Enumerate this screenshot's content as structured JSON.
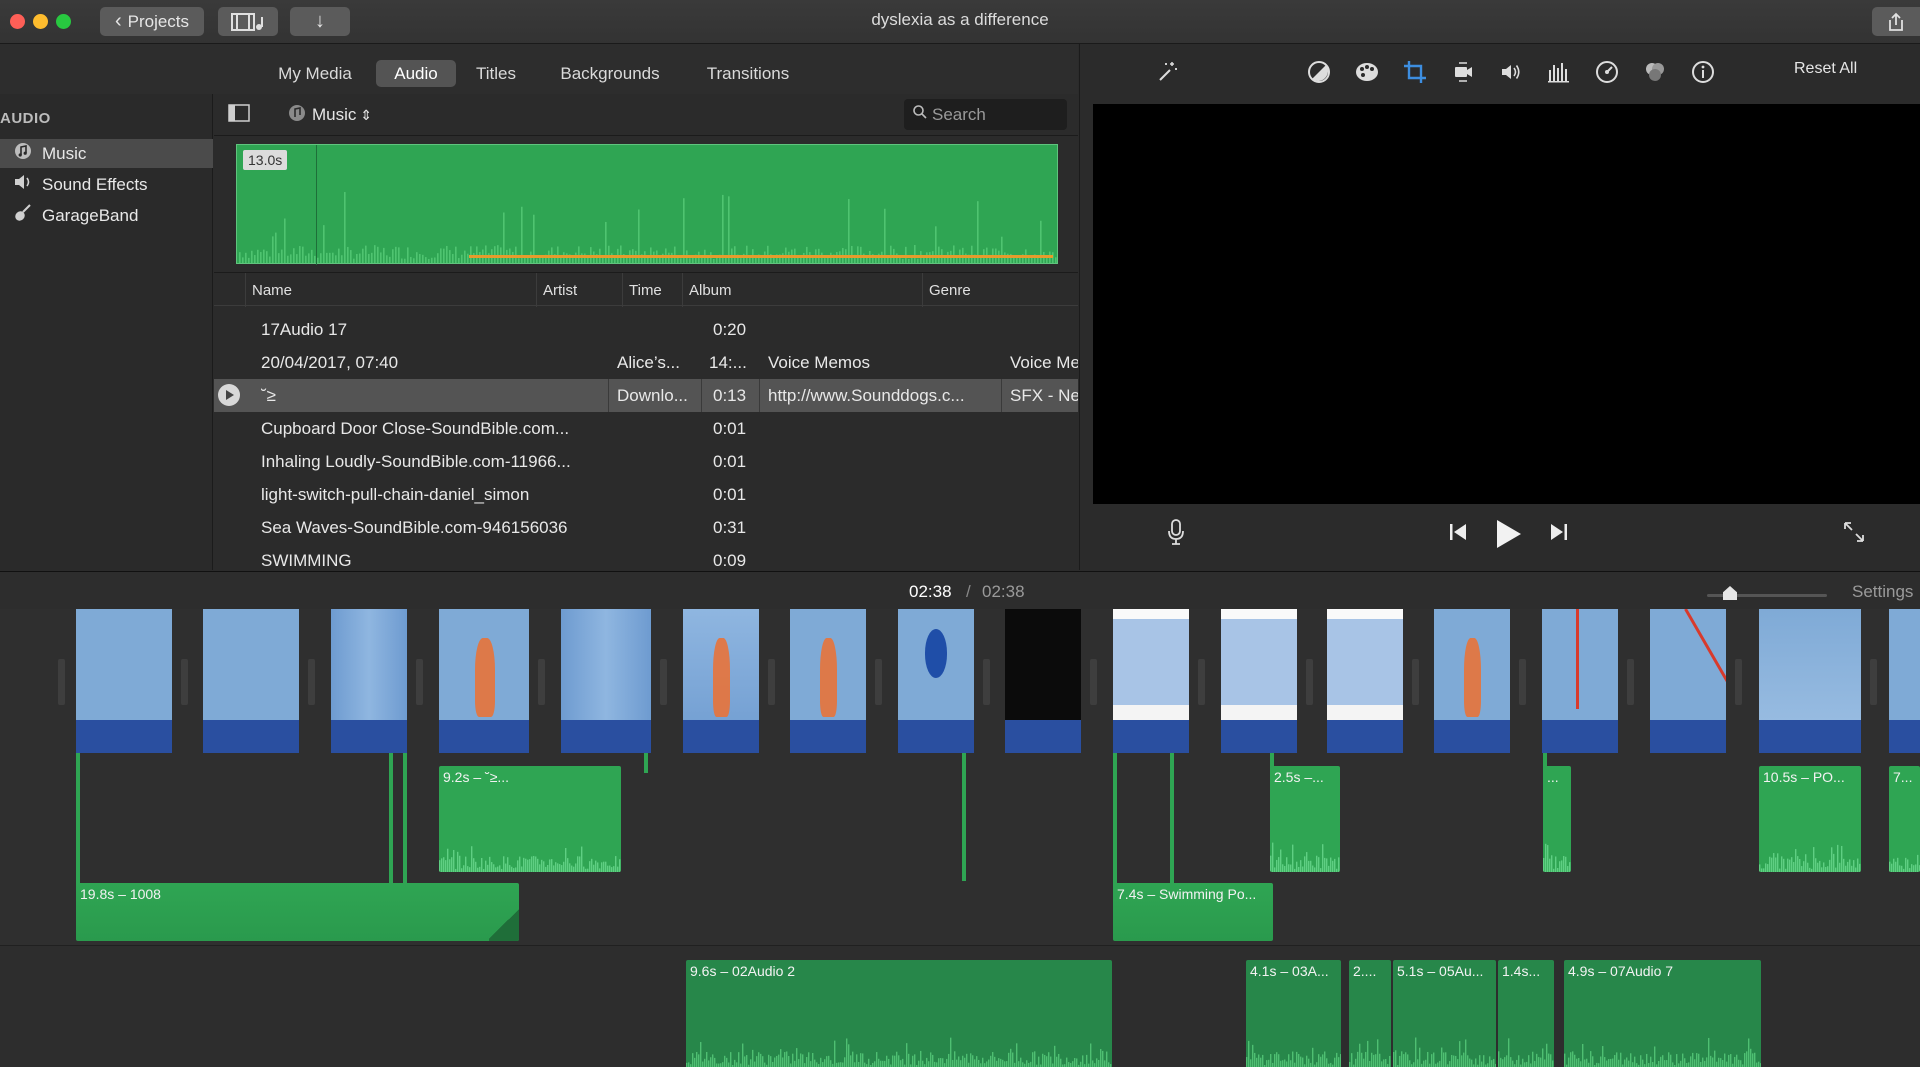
{
  "window": {
    "title": "dyslexia as a difference",
    "projects_label": "Projects"
  },
  "tabs": [
    {
      "label": "My Media",
      "active": false
    },
    {
      "label": "Audio",
      "active": true
    },
    {
      "label": "Titles",
      "active": false
    },
    {
      "label": "Backgrounds",
      "active": false
    },
    {
      "label": "Transitions",
      "active": false
    }
  ],
  "sidebar": {
    "heading": "AUDIO",
    "items": [
      {
        "label": "Music",
        "icon": "music-note-icon",
        "selected": true
      },
      {
        "label": "Sound Effects",
        "icon": "speaker-icon",
        "selected": false
      },
      {
        "label": "GarageBand",
        "icon": "guitar-icon",
        "selected": false
      }
    ]
  },
  "browser": {
    "source_label": "Music",
    "search_placeholder": "Search",
    "preview_duration": "13.0s",
    "columns": [
      "Name",
      "Artist",
      "Time",
      "Album",
      "Genre"
    ],
    "rows": [
      {
        "name": "17Audio 17",
        "artist": "",
        "time": "0:20",
        "album": "",
        "genre": ""
      },
      {
        "name": "20/04/2017, 07:40",
        "artist": "Alice’s...",
        "time": "14:...",
        "album": "Voice Memos",
        "genre": "Voice Me"
      },
      {
        "name": "˘≥",
        "artist": "Downlo...",
        "time": "0:13",
        "album": "http://www.Sounddogs.c...",
        "genre": "SFX - Ne",
        "selected": true
      },
      {
        "name": "Cupboard Door Close-SoundBible.com...",
        "artist": "",
        "time": "0:01",
        "album": "",
        "genre": ""
      },
      {
        "name": "Inhaling Loudly-SoundBible.com-11966...",
        "artist": "",
        "time": "0:01",
        "album": "",
        "genre": ""
      },
      {
        "name": "light-switch-pull-chain-daniel_simon",
        "artist": "",
        "time": "0:01",
        "album": "",
        "genre": ""
      },
      {
        "name": "Sea Waves-SoundBible.com-946156036",
        "artist": "",
        "time": "0:31",
        "album": "",
        "genre": ""
      },
      {
        "name": "SWIMMING",
        "artist": "",
        "time": "0:09",
        "album": "",
        "genre": ""
      }
    ]
  },
  "viewer": {
    "reset_all": "Reset All"
  },
  "timeline": {
    "current_time": "02:38",
    "separator": "/",
    "total_time": "02:38",
    "settings": "Settings",
    "audio_clips": [
      {
        "label": "9.2s – ˘≥..."
      },
      {
        "label": "2.5s –..."
      },
      {
        "label": "..."
      },
      {
        "label": "10.5s – PO..."
      },
      {
        "label": "7..."
      },
      {
        "label": "19.8s – 1008"
      },
      {
        "label": "7.4s – Swimming Po..."
      }
    ],
    "background_clips": [
      {
        "label": "9.6s – 02Audio 2"
      },
      {
        "label": "4.1s – 03A..."
      },
      {
        "label": "2...."
      },
      {
        "label": "5.1s – 05Au..."
      },
      {
        "label": "1.4s..."
      },
      {
        "label": "4.9s – 07Audio 7"
      }
    ]
  },
  "colors": {
    "audio_green": "#2fa553",
    "bgm_green": "#27874a",
    "clip_blue": "#2a4fa0",
    "crop_active": "#3d8ee0"
  }
}
